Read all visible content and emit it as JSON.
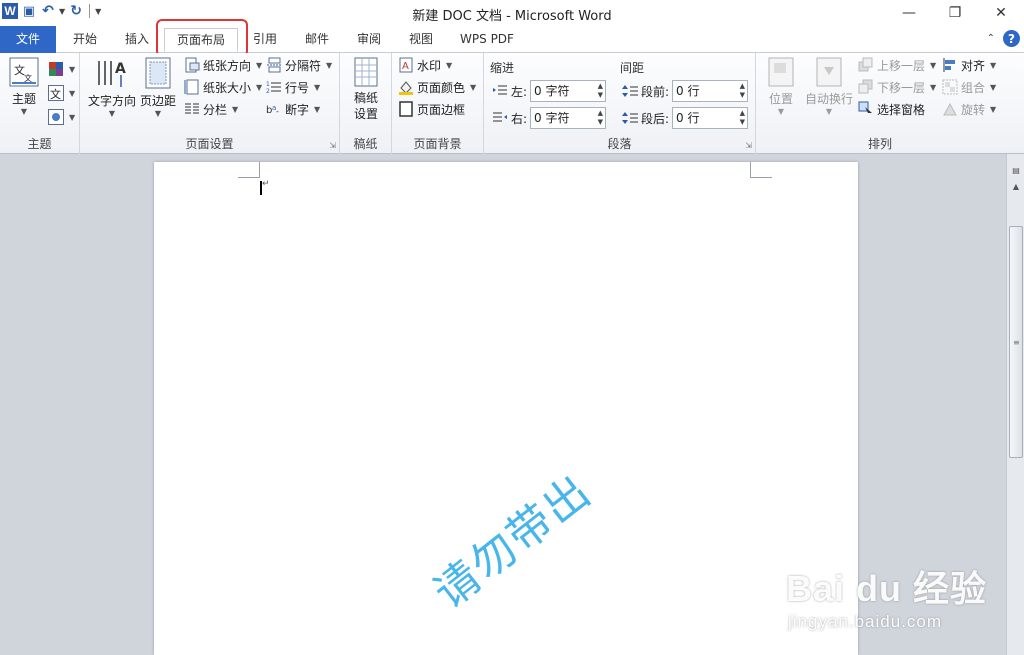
{
  "window": {
    "title": "新建 DOC 文档 - Microsoft Word"
  },
  "tabs": [
    "文件",
    "开始",
    "插入",
    "页面布局",
    "引用",
    "邮件",
    "审阅",
    "视图",
    "WPS PDF"
  ],
  "active_tab": "页面布局",
  "ribbon": {
    "theme_group": {
      "label": "主题",
      "theme_button": "主题"
    },
    "page_setup": {
      "label": "页面设置",
      "text_direction": "文字方向",
      "margins": "页边距",
      "orientation": "纸张方向",
      "size": "纸张大小",
      "columns": "分栏",
      "breaks": "分隔符",
      "line_numbers": "行号",
      "hyphenation": "断字"
    },
    "manuscript": {
      "label": "稿纸",
      "settings_line1": "稿纸",
      "settings_line2": "设置"
    },
    "page_background": {
      "label": "页面背景",
      "watermark": "水印",
      "page_color": "页面颜色",
      "page_borders": "页面边框"
    },
    "paragraph": {
      "label": "段落",
      "indent_head": "缩进",
      "spacing_head": "间距",
      "left_label": "左:",
      "left_value": "0 字符",
      "right_label": "右:",
      "right_value": "0 字符",
      "before_label": "段前:",
      "before_value": "0 行",
      "after_label": "段后:",
      "after_value": "0 行"
    },
    "arrange": {
      "label": "排列",
      "position": "位置",
      "wrap_text": "自动换行",
      "bring_forward": "上移一层",
      "send_backward": "下移一层",
      "selection_pane": "选择窗格",
      "align": "对齐",
      "group": "组合",
      "rotate": "旋转"
    }
  },
  "watermark": {
    "diagonal": "请勿带出",
    "brand": "Bai du 经验",
    "brand_url": "jingyan.baidu.com"
  },
  "colors": {
    "file_tab": "#2f67c7",
    "highlight": "#e03535",
    "watermark": "#29a9e8"
  }
}
